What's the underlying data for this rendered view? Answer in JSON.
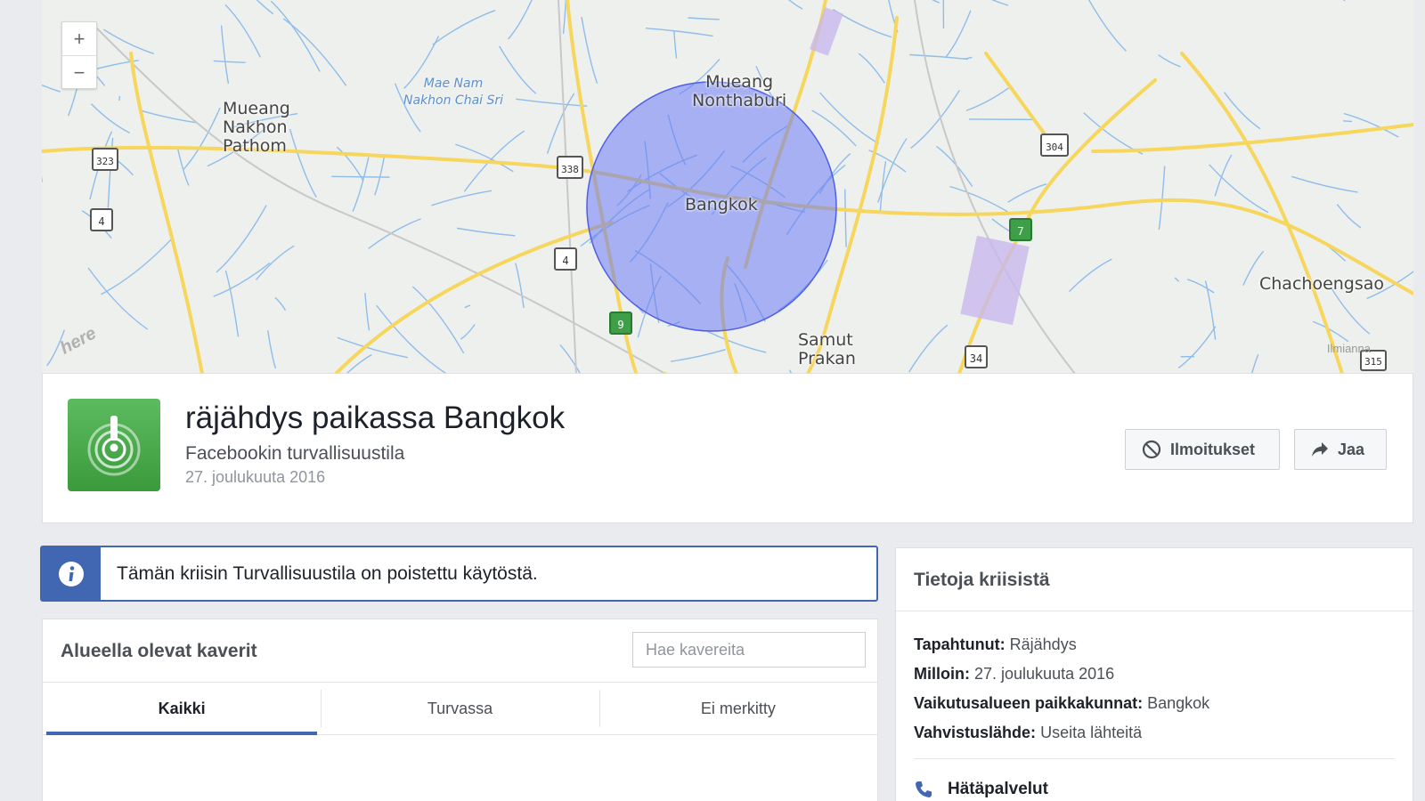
{
  "map": {
    "zoom_in_label": "+",
    "zoom_out_label": "−",
    "places": {
      "nakhon_pathom": "Mueang\nNakhon\nPathom",
      "nonthaburi": "Mueang\nNonthaburi",
      "bangkok": "Bangkok",
      "samut_prakan": "Samut\nPrakan",
      "chachoengsao": "Chachoengsao"
    },
    "water_label": "Mae Nam\nNakhon Chai Sri",
    "road_shields": {
      "r323": "323",
      "r4a": "4",
      "r338": "338",
      "r4b": "4",
      "r9": "9",
      "r304": "304",
      "r7": "7",
      "r34": "34",
      "r315": "315"
    },
    "logo": "here",
    "attribution": "Ilmianna",
    "colors": {
      "circle_fill": "#6c7cf5",
      "road": "#f6d65c",
      "water": "#7fb3ea"
    }
  },
  "crisis": {
    "title": "räjähdys paikassa Bangkok",
    "subtitle": "Facebookin turvallisuustila",
    "date": "27. joulukuuta 2016",
    "icon": "safety-check-icon",
    "notifications_label": "Ilmoitukset",
    "share_label": "Jaa"
  },
  "notice": {
    "icon": "info-icon",
    "text": "Tämän kriisin Turvallisuustila on poistettu käytöstä."
  },
  "friends": {
    "title": "Alueella olevat kaverit",
    "search_placeholder": "Hae kavereita",
    "tabs": [
      {
        "label": "Kaikki",
        "active": true
      },
      {
        "label": "Turvassa",
        "active": false
      },
      {
        "label": "Ei merkitty",
        "active": false
      }
    ]
  },
  "info": {
    "title": "Tietoja kriisistä",
    "rows": [
      {
        "key": "Tapahtunut:",
        "value": "Räjähdys"
      },
      {
        "key": "Milloin:",
        "value": "27. joulukuuta 2016"
      },
      {
        "key": "Vaikutusalueen paikkakunnat:",
        "value": "Bangkok"
      },
      {
        "key": "Vahvistuslähde:",
        "value": "Useita lähteitä"
      }
    ],
    "emergency_label": "Hätäpalvelut"
  }
}
